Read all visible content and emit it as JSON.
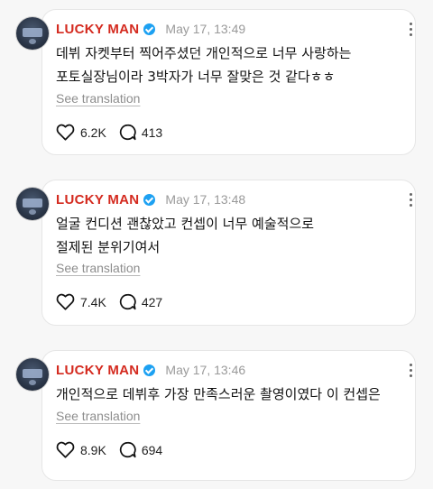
{
  "posts": [
    {
      "author": "LUCKY MAN",
      "timestamp": "May 17, 13:49",
      "lines": [
        "데뷔 자켓부터 찍어주셨던 개인적으로 너무 사랑하는",
        "포토실장님이라 3박자가 너무 잘맞은 것 같다ㅎㅎ"
      ],
      "see_translation": "See translation",
      "likes": "6.2K",
      "comments": "413"
    },
    {
      "author": "LUCKY MAN",
      "timestamp": "May 17, 13:48",
      "lines": [
        "얼굴 컨디션 괜찮았고 컨셉이 너무 예술적으로",
        "절제된 분위기여서"
      ],
      "see_translation": "See translation",
      "likes": "7.4K",
      "comments": "427"
    },
    {
      "author": "LUCKY MAN",
      "timestamp": "May 17, 13:46",
      "lines": [
        "개인적으로 데뷔후 가장 만족스러운 촬영이였다 이 컨셉은"
      ],
      "see_translation": "See translation",
      "likes": "8.9K",
      "comments": "694"
    }
  ],
  "colors": {
    "author": "#d42a1f",
    "verified": "#1da1f2",
    "timestamp": "#9a9a9a",
    "background": "#f7f7f7"
  },
  "icons": [
    "verified-badge-icon",
    "more-options-icon",
    "heart-icon",
    "comment-icon"
  ]
}
